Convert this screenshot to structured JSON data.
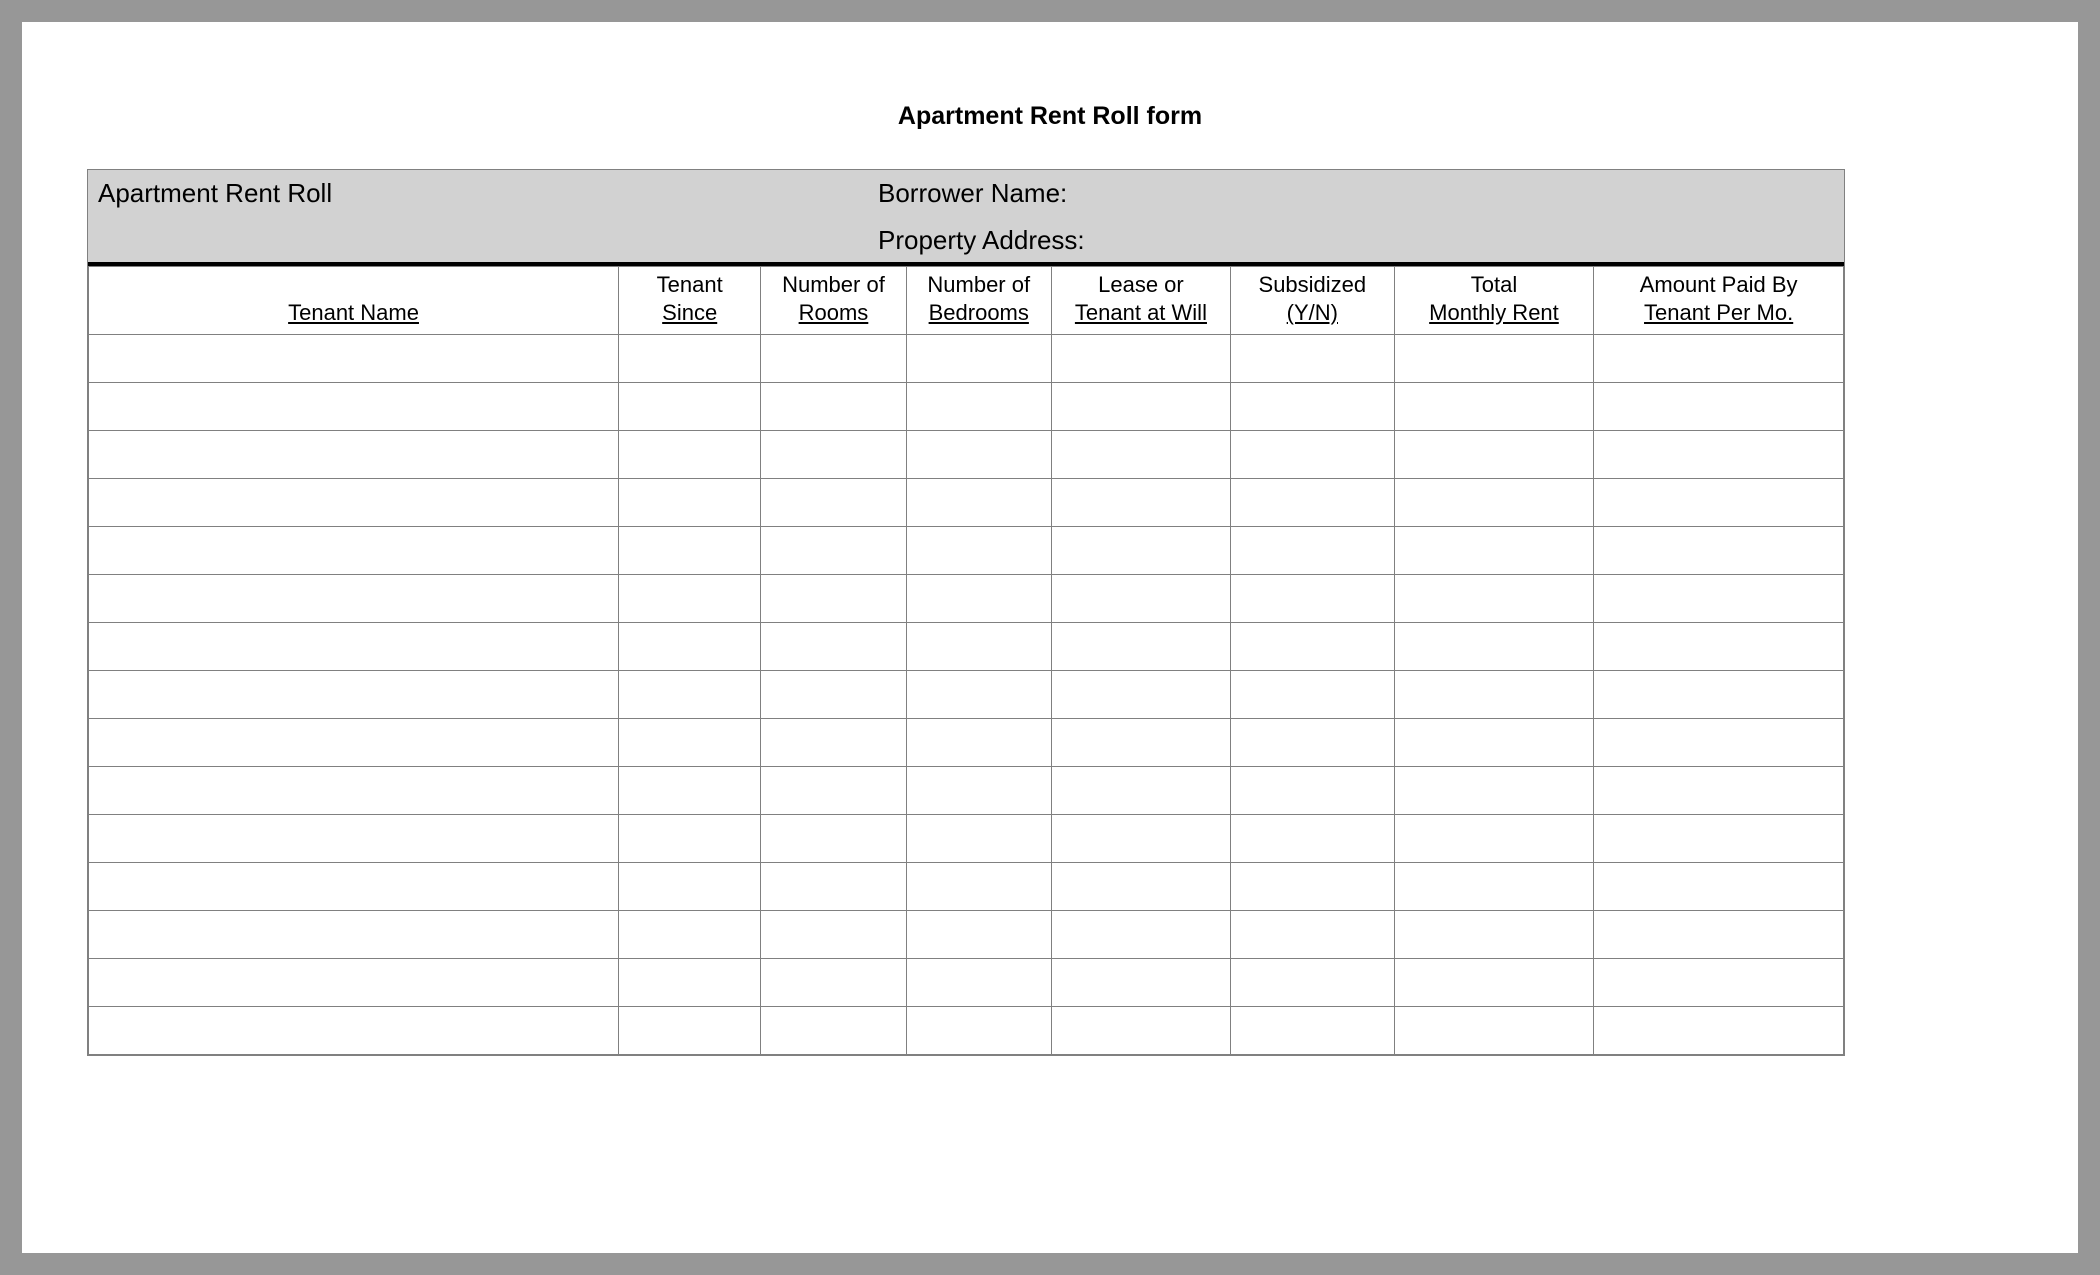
{
  "title": "Apartment Rent Roll form",
  "header": {
    "subtitle": "Apartment Rent Roll",
    "borrower_label": "Borrower Name:",
    "property_label": "Property Address:"
  },
  "columns": [
    {
      "line1": "",
      "line2": "Tenant Name"
    },
    {
      "line1": "Tenant",
      "line2": "Since"
    },
    {
      "line1": "Number of",
      "line2": "Rooms"
    },
    {
      "line1": "Number of",
      "line2": "Bedrooms"
    },
    {
      "line1": "Lease or",
      "line2": "Tenant at Will"
    },
    {
      "line1": "Subsidized",
      "line2": "(Y/N)"
    },
    {
      "line1": "Total",
      "line2": "Monthly Rent"
    },
    {
      "line1": "Amount Paid By",
      "line2": "Tenant Per Mo."
    }
  ],
  "row_count": 15
}
